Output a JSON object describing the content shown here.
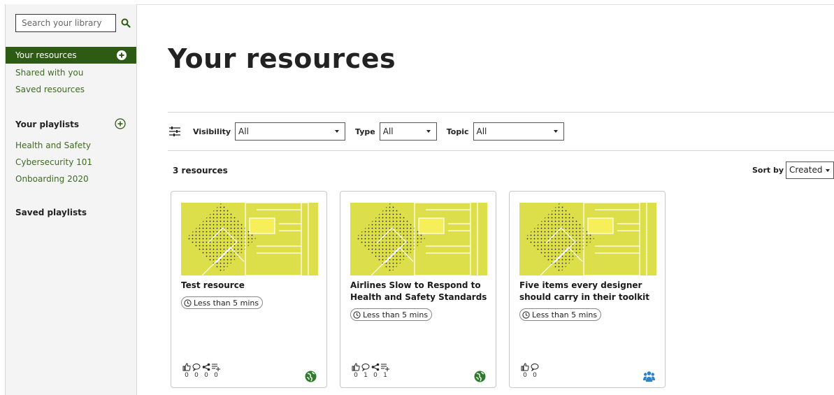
{
  "sidebar": {
    "search_placeholder": "Search your library",
    "nav": [
      {
        "label": "Your resources",
        "active": true
      },
      {
        "label": "Shared with you"
      },
      {
        "label": "Saved resources"
      }
    ],
    "playlists_heading": "Your playlists",
    "playlists": [
      "Health and Safety",
      "Cybersecurity 101",
      "Onboarding 2020"
    ],
    "saved_playlists_heading": "Saved playlists"
  },
  "main": {
    "title": "Your resources",
    "filters": {
      "visibility_label": "Visibility",
      "visibility_value": "All",
      "type_label": "Type",
      "type_value": "All",
      "topic_label": "Topic",
      "topic_value": "All"
    },
    "count_text": "3 resources",
    "sort_label": "Sort by",
    "sort_value": "Created"
  },
  "cards": [
    {
      "title": "Test resource",
      "duration": "Less than 5 mins",
      "stats": {
        "likes": "0",
        "comments": "0",
        "shares": "0",
        "playlists": "0"
      },
      "visibility_icon": "globe-icon"
    },
    {
      "title": "Airlines Slow to Respond to Health and Safety Standards",
      "duration": "Less than 5 mins",
      "stats": {
        "likes": "0",
        "comments": "1",
        "shares": "0",
        "playlists": "1"
      },
      "visibility_icon": "globe-icon"
    },
    {
      "title": "Five items every designer should carry in their toolkit",
      "duration": "Less than 5 mins",
      "stats": {
        "likes": "0",
        "comments": "0"
      },
      "visibility_icon": "people-icon"
    }
  ],
  "colors": {
    "brand_green": "#2e5b14",
    "link_green": "#3d6b1e",
    "thumb_yellow": "#dcdf4a",
    "globe_green": "#2f7a2f",
    "people_blue": "#2b83c8"
  }
}
